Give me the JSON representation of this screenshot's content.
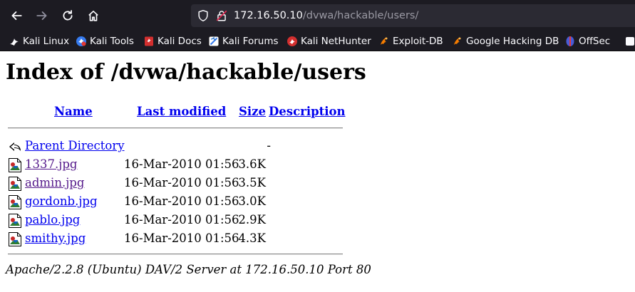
{
  "browser": {
    "url_host": "172.16.50.10",
    "url_path": "/dvwa/hackable/users/"
  },
  "bookmarks": [
    {
      "label": "Kali Linux",
      "icon": "kali-dragon-icon"
    },
    {
      "label": "Kali Tools",
      "icon": "kali-tools-icon"
    },
    {
      "label": "Kali Docs",
      "icon": "kali-docs-icon"
    },
    {
      "label": "Kali Forums",
      "icon": "kali-forums-icon"
    },
    {
      "label": "Kali NetHunter",
      "icon": "nethunter-icon"
    },
    {
      "label": "Exploit-DB",
      "icon": "exploit-db-icon"
    },
    {
      "label": "Google Hacking DB",
      "icon": "ghdb-icon"
    },
    {
      "label": "OffSec",
      "icon": "offsec-icon"
    }
  ],
  "page": {
    "title": "Index of /dvwa/hackable/users",
    "columns": {
      "name": "Name",
      "last_modified": "Last modified",
      "size": "Size",
      "description": "Description"
    },
    "parent": {
      "name": "Parent Directory",
      "size": "-"
    },
    "files": [
      {
        "name": "1337.jpg",
        "modified": "16-Mar-2010 01:56",
        "size": "3.6K",
        "visited": true
      },
      {
        "name": "admin.jpg",
        "modified": "16-Mar-2010 01:56",
        "size": "3.5K",
        "visited": true
      },
      {
        "name": "gordonb.jpg",
        "modified": "16-Mar-2010 01:56",
        "size": "3.0K",
        "visited": false
      },
      {
        "name": "pablo.jpg",
        "modified": "16-Mar-2010 01:56",
        "size": "2.9K",
        "visited": false
      },
      {
        "name": "smithy.jpg",
        "modified": "16-Mar-2010 01:56",
        "size": "4.3K",
        "visited": false
      }
    ],
    "server_signature": "Apache/2.2.8 (Ubuntu) DAV/2 Server at 172.16.50.10 Port 80"
  },
  "colors": {
    "chrome_bg": "#1c1b22",
    "urlbar_bg": "#2b2a33",
    "link": "#0000ee",
    "visited_link": "#551a8b"
  }
}
